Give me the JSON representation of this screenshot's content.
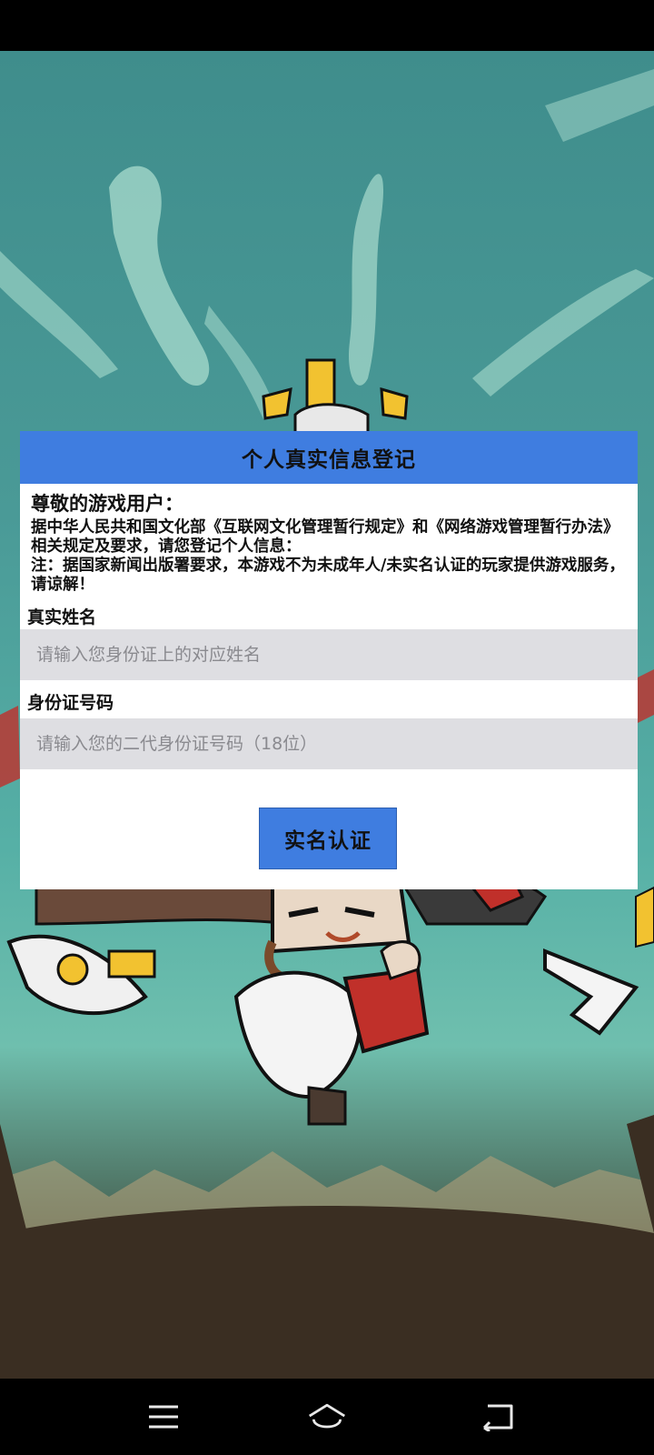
{
  "dialog": {
    "title": "个人真实信息登记",
    "greeting": "尊敬的游戏用户：",
    "notice_line1": "据中华人民共和国文化部《互联网文化管理暂行规定》和《网络游戏管理暂行办法》相关规定及要求，请您登记个人信息：",
    "notice_line2": "注：据国家新闻出版署要求，本游戏不为未成年人/未实名认证的玩家提供游戏服务，请谅解！",
    "name_label": "真实姓名",
    "name_placeholder": "请输入您身份证上的对应姓名",
    "name_value": "",
    "id_label": "身份证号码",
    "id_placeholder": "请输入您的二代身份证号码（18位）",
    "id_value": "",
    "submit_label": "实名认证"
  },
  "navigation": {
    "menu_icon": "menu-icon",
    "home_icon": "home-icon",
    "back_icon": "back-icon"
  },
  "colors": {
    "header_blue": "#3f7de0",
    "input_gray": "#dedee2",
    "background_teal": "#4a9a97"
  }
}
